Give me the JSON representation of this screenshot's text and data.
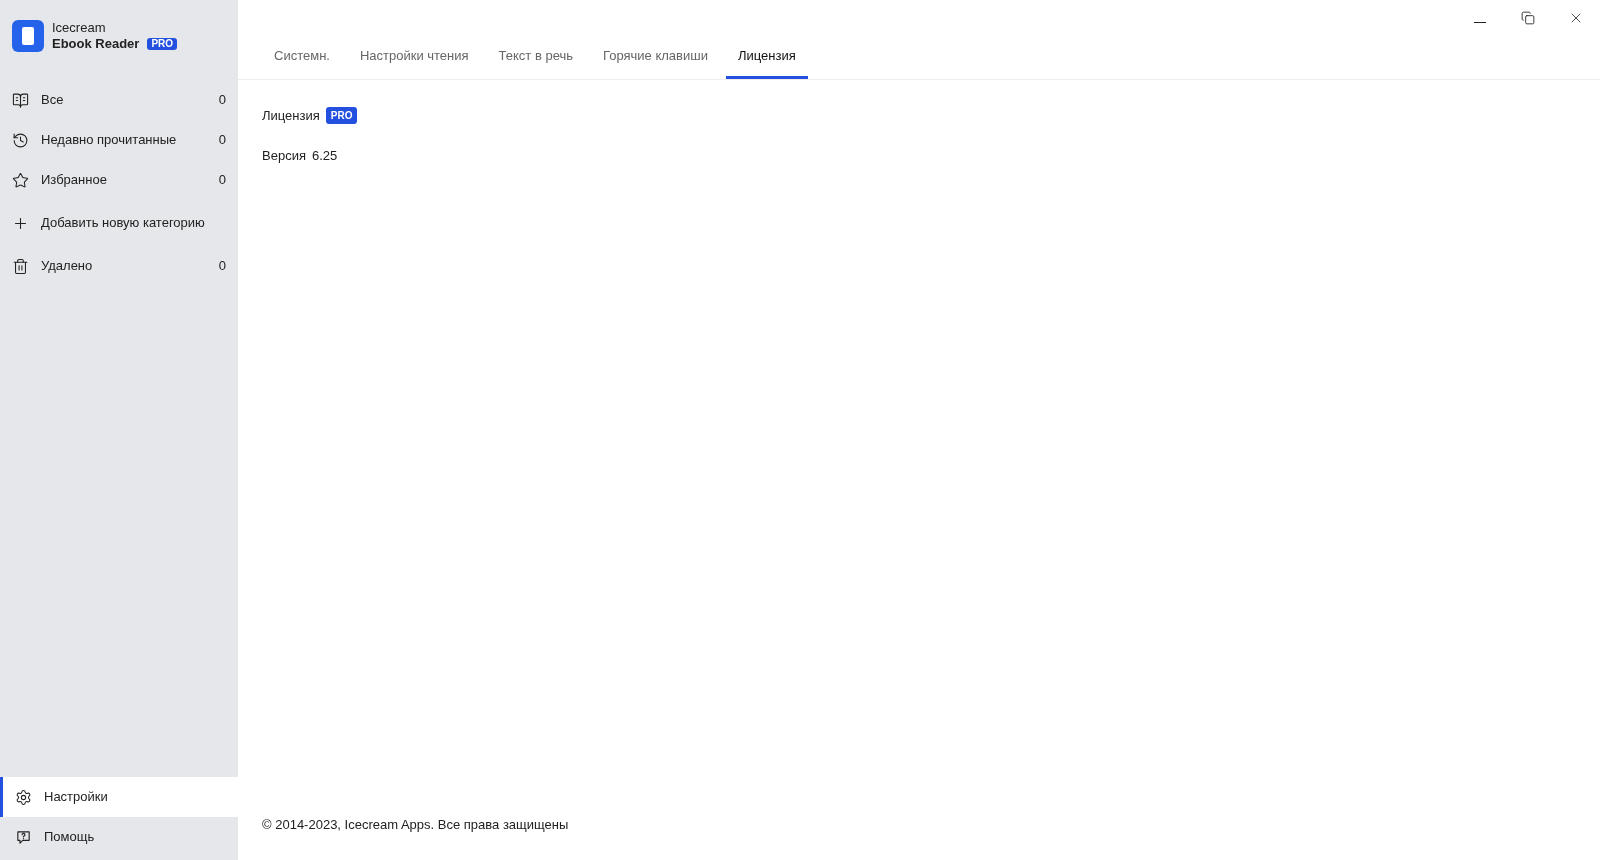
{
  "app": {
    "name_line_1": "Icecream",
    "name_line_2": "Ebook Reader",
    "badge": "PRO"
  },
  "sidebar": {
    "items": [
      {
        "kind": "count",
        "label": "Все",
        "count": "0"
      },
      {
        "kind": "count",
        "label": "Недавно прочитанные",
        "count": "0"
      },
      {
        "kind": "count",
        "label": "Избранное",
        "count": "0"
      },
      {
        "kind": "add",
        "label": "Добавить новую категорию"
      },
      {
        "kind": "count",
        "label": "Удалено",
        "count": "0"
      }
    ],
    "bottom_items": [
      {
        "label": "Настройки",
        "selected": true
      },
      {
        "label": "Помощь",
        "selected": false
      }
    ]
  },
  "tabs": [
    {
      "label": "Системн.",
      "selected": false
    },
    {
      "label": "Настройки чтения",
      "selected": false
    },
    {
      "label": "Текст в речь",
      "selected": false
    },
    {
      "label": "Горячие клавиши",
      "selected": false
    },
    {
      "label": "Лицензия",
      "selected": true
    }
  ],
  "license": {
    "label": "Лицензия",
    "badge": "PRO",
    "version_label": "Версия",
    "version": "6.25"
  },
  "footer": "© 2014-2023, Icecream Apps. Все права защищены"
}
